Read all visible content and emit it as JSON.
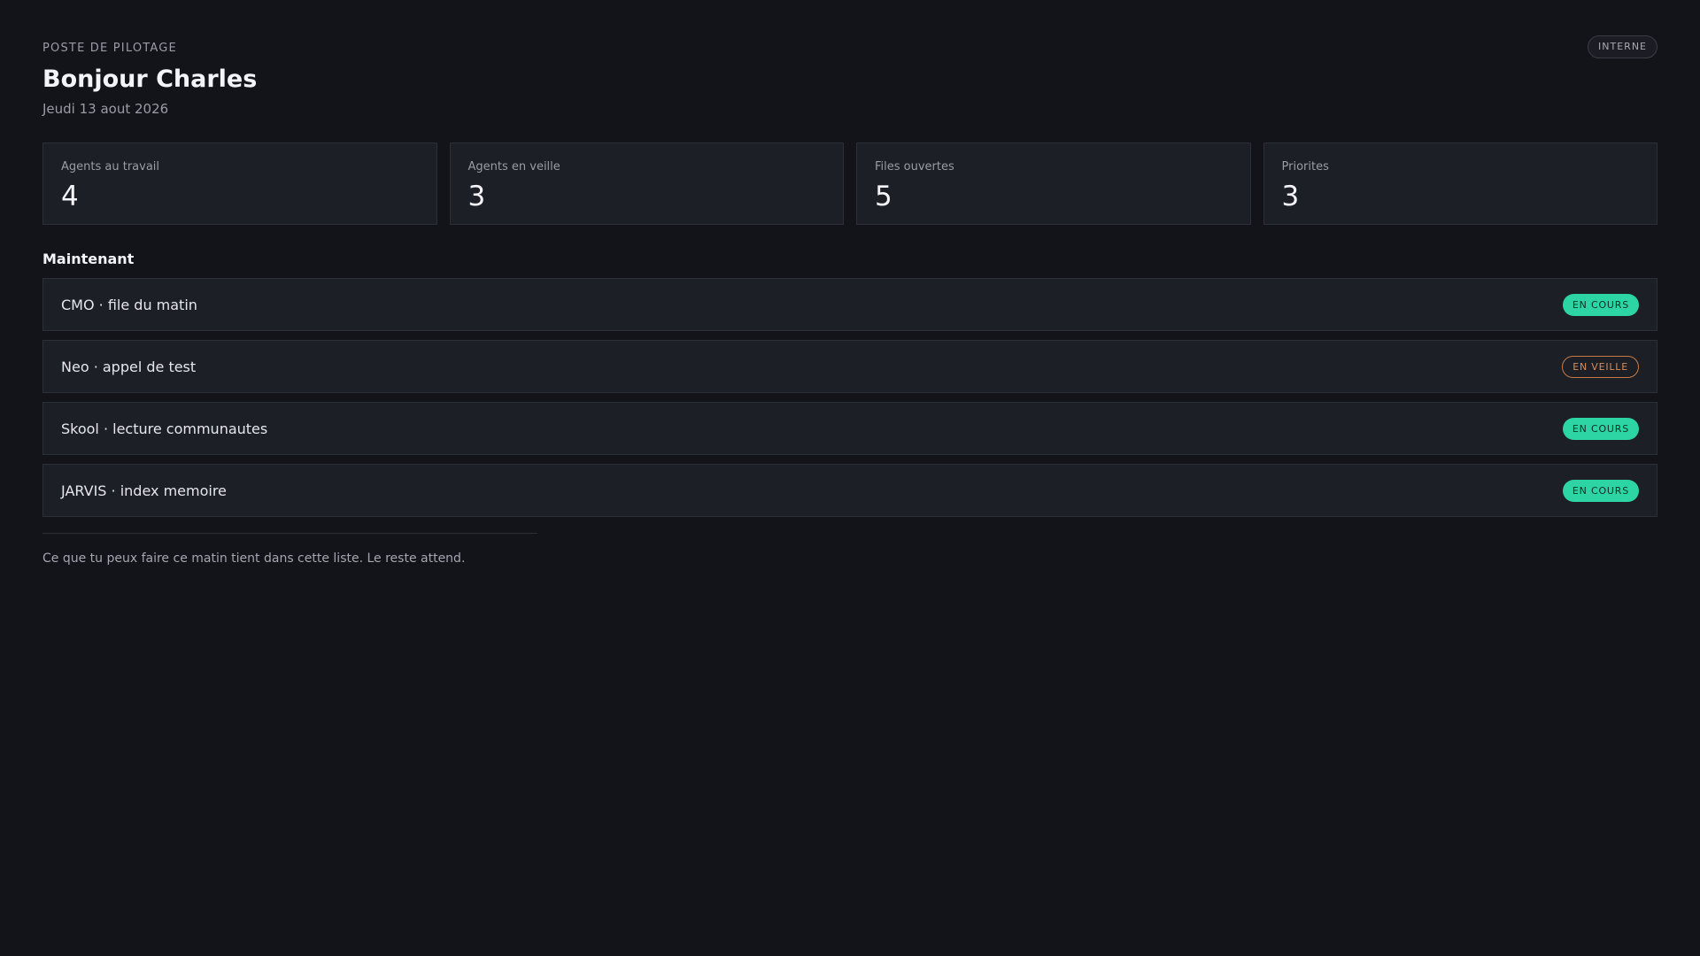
{
  "header": {
    "eyebrow": "POSTE DE PILOTAGE",
    "title": "Bonjour Charles",
    "date": "Jeudi 13 aout 2026",
    "tag": "INTERNE"
  },
  "stats": [
    {
      "label": "Agents au travail",
      "value": "4"
    },
    {
      "label": "Agents en veille",
      "value": "3"
    },
    {
      "label": "Files ouvertes",
      "value": "5"
    },
    {
      "label": "Priorites",
      "value": "3"
    }
  ],
  "section": {
    "title": "Maintenant"
  },
  "tasks": [
    {
      "label": "CMO · file du matin",
      "status": "EN COURS"
    },
    {
      "label": "Neo · appel de test",
      "status": "EN VEILLE"
    },
    {
      "label": "Skool · lecture communautes",
      "status": "EN COURS"
    },
    {
      "label": "JARVIS · index memoire",
      "status": "EN COURS"
    }
  ],
  "footer": {
    "note": "Ce que tu peux faire ce matin tient dans cette liste. Le reste attend."
  },
  "colors": {
    "background": "#13141a",
    "card": "#1d1f27",
    "status_active": "#2dd4a4",
    "status_idle": "#c77a44"
  }
}
